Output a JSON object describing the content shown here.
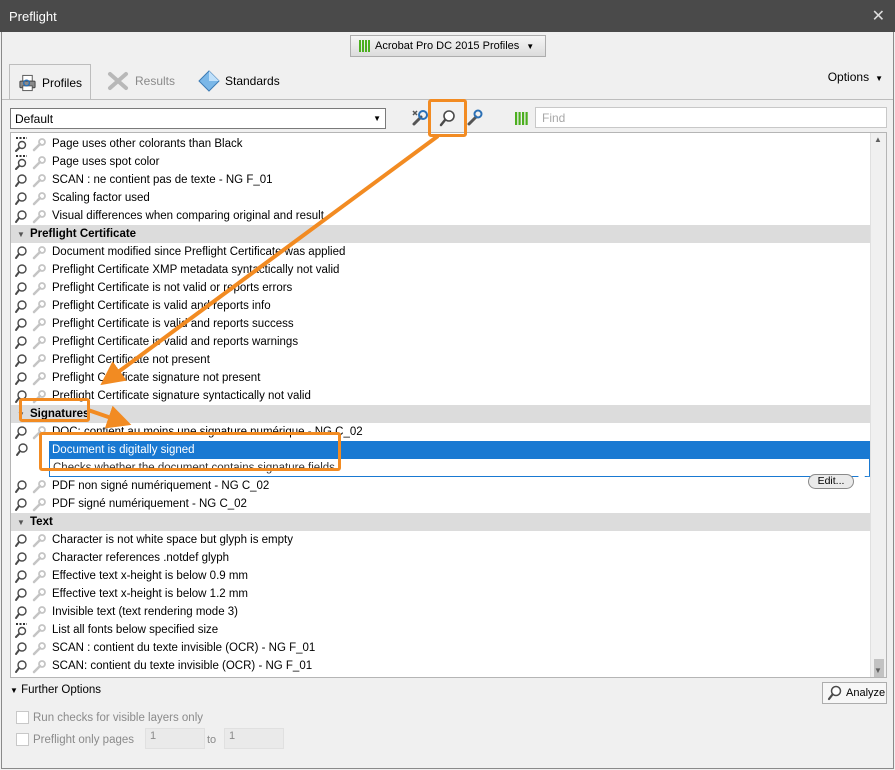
{
  "window": {
    "title": "Preflight",
    "close": "✕"
  },
  "profiles_menu": {
    "label": "Acrobat Pro DC 2015 Profiles"
  },
  "tabs": [
    {
      "label": "Profiles"
    },
    {
      "label": "Results"
    },
    {
      "label": "Standards"
    }
  ],
  "options_label": "Options",
  "toolbar": {
    "library_value": "Default",
    "find_placeholder": "Find"
  },
  "list": {
    "rows": [
      {
        "kind": "fix",
        "label": "Page uses other colorants than Black"
      },
      {
        "kind": "fix",
        "label": "Page uses spot color"
      },
      {
        "kind": "check",
        "label": "SCAN : ne contient pas de texte - NG F_01"
      },
      {
        "kind": "check",
        "label": "Scaling factor used"
      },
      {
        "kind": "check",
        "label": "Visual differences when comparing original and result"
      },
      {
        "kind": "category",
        "label": "Preflight Certificate"
      },
      {
        "kind": "check",
        "label": "Document modified since Preflight Certificate was applied"
      },
      {
        "kind": "check",
        "label": "Preflight Certificate XMP metadata syntactically not valid"
      },
      {
        "kind": "check",
        "label": "Preflight Certificate is not valid or reports errors"
      },
      {
        "kind": "check",
        "label": "Preflight Certificate is valid and reports info"
      },
      {
        "kind": "check",
        "label": "Preflight Certificate is valid and reports success"
      },
      {
        "kind": "check",
        "label": "Preflight Certificate is valid and reports warnings"
      },
      {
        "kind": "check",
        "label": "Preflight Certificate not present"
      },
      {
        "kind": "check",
        "label": "Preflight Certificate signature not present"
      },
      {
        "kind": "check",
        "label": "Preflight Certificate signature syntactically not valid"
      },
      {
        "kind": "category",
        "label": "Signatures"
      },
      {
        "kind": "check",
        "label": "DOC: contient au moins une signature numérique - NG C_02"
      },
      {
        "kind": "selected",
        "label": "Document is digitally signed",
        "edit": "Edit..."
      },
      {
        "kind": "description",
        "label": "Checks whether the document contains signature fields"
      },
      {
        "kind": "check",
        "label": "PDF non signé numériquement - NG C_02"
      },
      {
        "kind": "check",
        "label": "PDF signé numériquement - NG C_02"
      },
      {
        "kind": "category",
        "label": "Text"
      },
      {
        "kind": "check",
        "label": "Character is not white space but glyph is empty"
      },
      {
        "kind": "check",
        "label": "Character references .notdef glyph"
      },
      {
        "kind": "check",
        "label": "Effective text x-height is below 0.9 mm"
      },
      {
        "kind": "check",
        "label": "Effective text x-height is below 1.2 mm"
      },
      {
        "kind": "check",
        "label": "Invisible text (text rendering mode 3)"
      },
      {
        "kind": "fix",
        "label": "List all fonts below specified size"
      },
      {
        "kind": "check",
        "label": "SCAN : contient du texte invisible (OCR) - NG F_01"
      },
      {
        "kind": "check",
        "label": "SCAN: contient du texte invisible (OCR) - NG F_01"
      }
    ]
  },
  "bottom": {
    "further_options": "Further Options",
    "analyze": "Analyze",
    "visible_layers": "Run checks for visible layers only",
    "pages_only": "Preflight only pages",
    "page_from": "1",
    "to_label": "to",
    "page_to": "1"
  },
  "colors": {
    "selection": "#1979d2",
    "annotation": "#f28b22",
    "titlebar": "#4a4a4a"
  }
}
